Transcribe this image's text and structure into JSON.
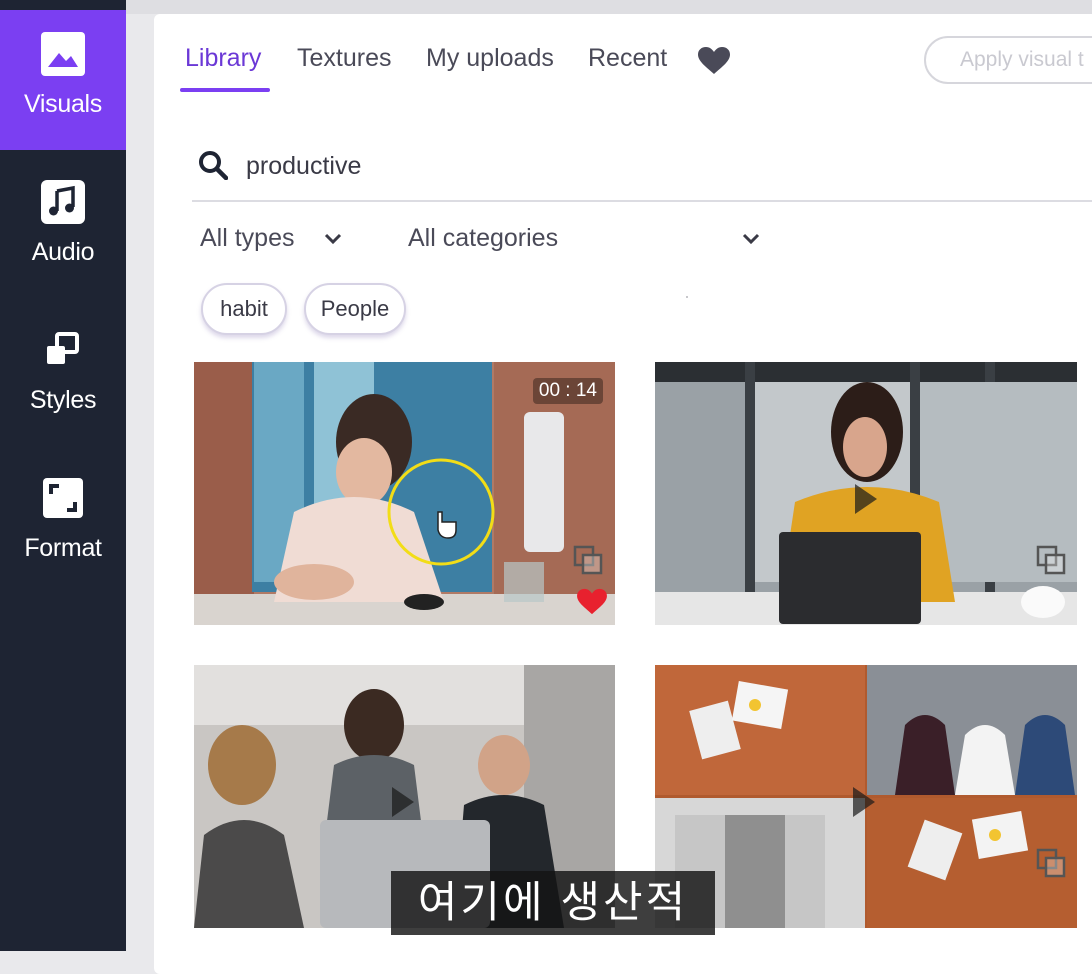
{
  "sidebar": {
    "items": [
      {
        "label": "Visuals",
        "icon": "image-icon",
        "active": true
      },
      {
        "label": "Audio",
        "icon": "music-note-icon"
      },
      {
        "label": "Styles",
        "icon": "styles-icon"
      },
      {
        "label": "Format",
        "icon": "format-icon"
      }
    ]
  },
  "tabs": [
    {
      "label": "Library",
      "active": true
    },
    {
      "label": "Textures"
    },
    {
      "label": "My uploads"
    },
    {
      "label": "Recent"
    }
  ],
  "apply_button": {
    "label": "Apply visual t"
  },
  "search": {
    "value": "productive"
  },
  "filters": {
    "type": "All types",
    "category": "All categories"
  },
  "chips": [
    "habit",
    "People"
  ],
  "results": [
    {
      "duration": "00 : 14",
      "favorited": true
    },
    {
      "duration": "",
      "favorited": false
    },
    {
      "duration": "",
      "favorited": false
    },
    {
      "duration": "",
      "favorited": false
    }
  ],
  "subtitle": "여기에 생산적",
  "colors": {
    "accent": "#7b3ff2",
    "sidebar": "#1e2433",
    "heart": "#e8212e"
  }
}
